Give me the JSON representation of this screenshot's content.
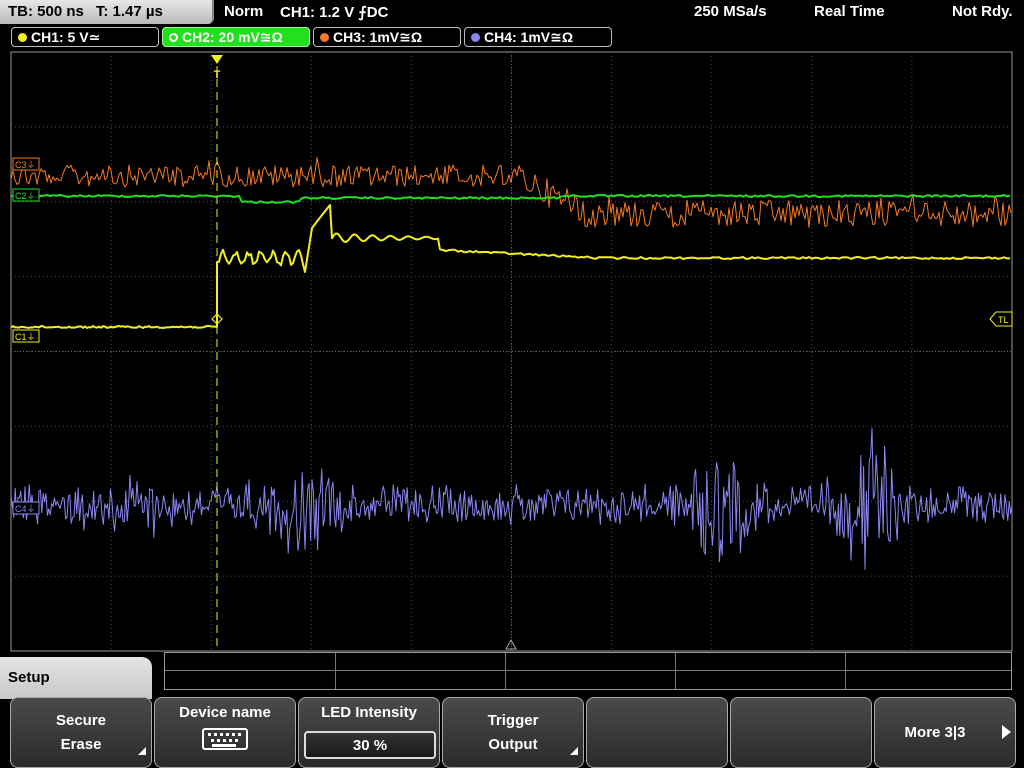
{
  "top_bar": {
    "timebase": "TB: 500 ns",
    "trigger_time": "T: 1.47 µs",
    "acq_mode": "Norm",
    "trigger_setting": "CH1: 1.2 V ⨍DC",
    "sample_rate": "250 MSa/s",
    "acquisition": "Real Time",
    "trigger_state": "Not Rdy."
  },
  "channels": [
    {
      "label": "CH1: 5 V≃",
      "color": "#f2f01c",
      "active": false
    },
    {
      "label": "CH2: 20 mV≅Ω",
      "color": "#22e01e",
      "active": true
    },
    {
      "label": "CH3: 1mV≅Ω",
      "color": "#f47a24",
      "active": false
    },
    {
      "label": "CH4: 1mV≅Ω",
      "color": "#8a86f0",
      "active": false
    }
  ],
  "markers": {
    "c1": "C1⏚",
    "c2": "C2⏚",
    "c3": "C3⏚",
    "c4": "C4⏚",
    "trigger_level": "TL",
    "trigger_pos": "T"
  },
  "menu": {
    "title": "Setup",
    "softkeys": [
      {
        "line1": "Secure",
        "line2": "Erase"
      },
      {
        "line1": "Device name",
        "icon": "keyboard-icon"
      },
      {
        "line1": "LED Intensity",
        "value": "30 %"
      },
      {
        "line1": "Trigger",
        "line2": "Output"
      },
      {
        "line1": ""
      },
      {
        "line1": ""
      },
      {
        "line1": "More 3|3"
      }
    ]
  }
}
